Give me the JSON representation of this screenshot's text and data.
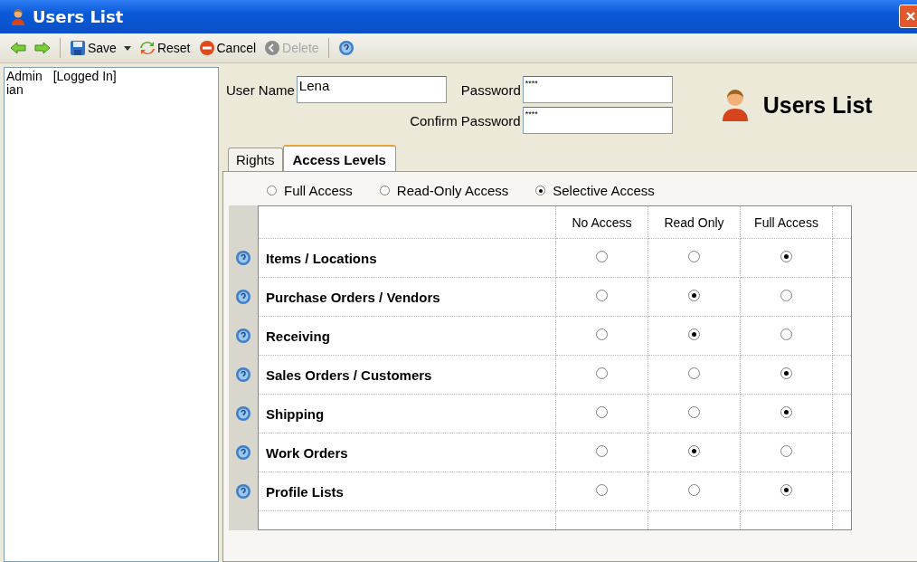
{
  "window": {
    "title": "Users List"
  },
  "toolbar": {
    "buttons": [
      {
        "kind": "back"
      },
      {
        "kind": "forward"
      },
      {
        "kind": "save",
        "label": "Save",
        "disabled": false
      },
      {
        "kind": "reset",
        "label": "Reset",
        "disabled": false
      },
      {
        "kind": "cancel",
        "label": "Cancel",
        "disabled": false
      },
      {
        "kind": "delete",
        "label": "Delete",
        "disabled": true
      },
      {
        "kind": "help"
      }
    ]
  },
  "users": [
    {
      "name": "Admin",
      "status": "[Logged In]",
      "selected": false
    },
    {
      "name": "ian",
      "selected": false
    }
  ],
  "form": {
    "user_name_label": "User Name",
    "user_name": "Lena",
    "password_label": "Password",
    "password": "****",
    "confirm_label": "Confirm Password",
    "confirm": "****",
    "heading": "Users List"
  },
  "tabs": [
    {
      "label": "Rights",
      "selected": false
    },
    {
      "label": "Access Levels",
      "selected": true
    }
  ],
  "access_modes": [
    {
      "label": "Full Access",
      "selected": false
    },
    {
      "label": "Read-Only Access",
      "selected": false
    },
    {
      "label": "Selective Access",
      "selected": true
    }
  ],
  "table": {
    "columns": [
      "No Access",
      "Read Only",
      "Full Access"
    ],
    "rows": [
      {
        "name": "Items / Locations",
        "levels": [
          {
            "selected": false
          },
          {
            "selected": false
          },
          {
            "selected": true
          }
        ]
      },
      {
        "name": "Purchase Orders / Vendors",
        "levels": [
          {
            "selected": false
          },
          {
            "selected": true
          },
          {
            "selected": false
          }
        ]
      },
      {
        "name": "Receiving",
        "levels": [
          {
            "selected": false
          },
          {
            "selected": true
          },
          {
            "selected": false
          }
        ]
      },
      {
        "name": "Sales Orders / Customers",
        "levels": [
          {
            "selected": false
          },
          {
            "selected": false
          },
          {
            "selected": true
          }
        ]
      },
      {
        "name": "Shipping",
        "levels": [
          {
            "selected": false
          },
          {
            "selected": false
          },
          {
            "selected": true
          }
        ]
      },
      {
        "name": "Work Orders",
        "levels": [
          {
            "selected": false
          },
          {
            "selected": true
          },
          {
            "selected": false
          }
        ]
      },
      {
        "name": "Profile Lists",
        "levels": [
          {
            "selected": false
          },
          {
            "selected": false
          },
          {
            "selected": true
          }
        ]
      }
    ]
  }
}
